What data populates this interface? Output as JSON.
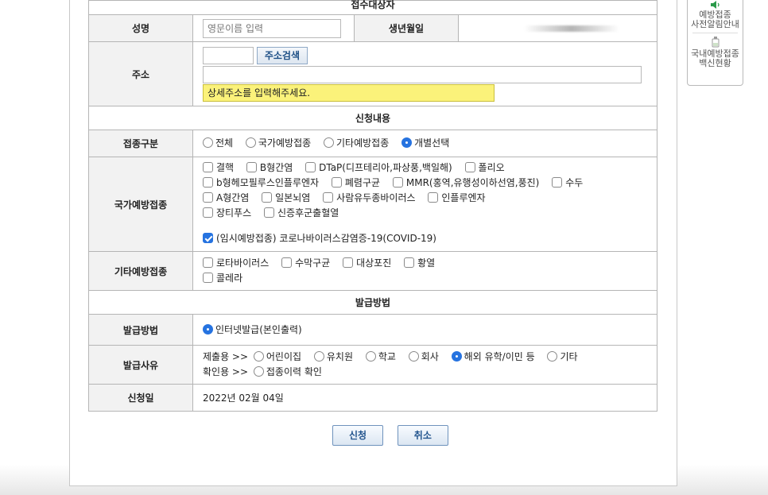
{
  "section_top": "접수대상자",
  "name": {
    "label": "성명",
    "placeholder": "영문이름 입력"
  },
  "dob": {
    "label": "생년월일"
  },
  "address": {
    "label": "주소",
    "search_button": "주소검색",
    "detail_prompt": "상세주소를 입력해주세요."
  },
  "request_section": "신청내용",
  "vaccination_type": {
    "label": "접종구분",
    "options": [
      "전체",
      "국가예방접종",
      "기타예방접종",
      "개별선택"
    ],
    "selected": 3
  },
  "national": {
    "label": "국가예방접종",
    "items": [
      "결핵",
      "B형간염",
      "DTaP(디프테리아,파상풍,백일해)",
      "폴리오",
      "b형헤모필루스인플루엔자",
      "폐렴구균",
      "MMR(홍역,유행성이하선염,풍진)",
      "수두",
      "A형간염",
      "일본뇌염",
      "사람유두종바이러스",
      "인플루엔자",
      "장티푸스",
      "신증후군출혈열"
    ],
    "covid": "(임시예방접종) 코로나바이러스감염증-19(COVID-19)"
  },
  "other": {
    "label": "기타예방접종",
    "items": [
      "로타바이러스",
      "수막구균",
      "대상포진",
      "황열",
      "콜레라"
    ]
  },
  "issue_section": "발급방법",
  "issue_method": {
    "label": "발급방법",
    "option": "인터넷발급(본인출력)"
  },
  "issue_reason": {
    "label": "발급사유",
    "submit_prefix": "제출용 >>",
    "submit_options": [
      "어린이집",
      "유치원",
      "학교",
      "회사",
      "해외 유학/이민 등",
      "기타"
    ],
    "selected": 4,
    "confirm_prefix": "확인용 >>",
    "confirm_option": "접종이력 확인"
  },
  "apply_date": {
    "label": "신청일",
    "value": "2022년 02월 04일"
  },
  "buttons": {
    "apply": "신청",
    "cancel": "취소"
  },
  "side": {
    "item1_line1": "예방접종",
    "item1_line2": "사전알림안내",
    "item2_line1": "국내예방접종",
    "item2_line2": "백신현황"
  }
}
